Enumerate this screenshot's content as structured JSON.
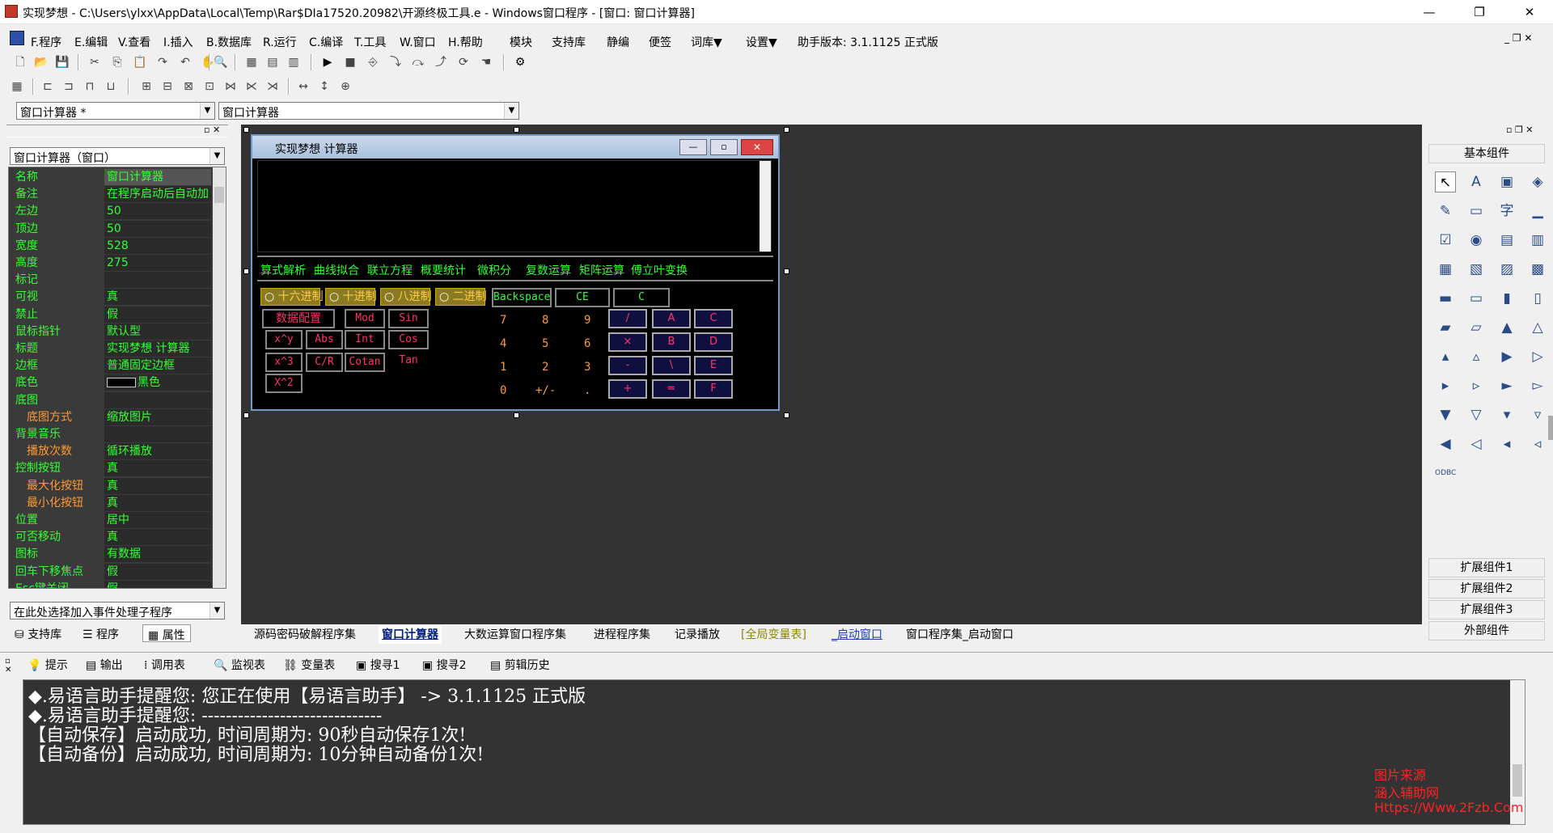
{
  "window": {
    "title": "实现梦想 - C:\\Users\\ylxx\\AppData\\Local\\Temp\\Rar$DIa17520.20982\\开源终极工具.e - Windows窗口程序 - [窗口: 窗口计算器]",
    "minimize": "—",
    "restore": "❐",
    "close": "✕"
  },
  "menu": [
    {
      "label": "F.程序"
    },
    {
      "label": "E.编辑"
    },
    {
      "label": "V.查看"
    },
    {
      "label": "I.插入"
    },
    {
      "label": "B.数据库"
    },
    {
      "label": "R.运行"
    },
    {
      "label": "C.编译"
    },
    {
      "label": "T.工具"
    },
    {
      "label": "W.窗口"
    },
    {
      "label": "H.帮助"
    },
    {
      "label": "模块"
    },
    {
      "label": "支持库"
    },
    {
      "label": "静编"
    },
    {
      "label": "便签"
    },
    {
      "label": "词库▼"
    },
    {
      "label": "设置▼"
    },
    {
      "label": "助手版本: 3.1.1125 正式版"
    }
  ],
  "combos": {
    "left": "窗口计算器 *",
    "right": "窗口计算器",
    "object": "窗口计算器（窗口）",
    "event": "在此处选择加入事件处理子程序"
  },
  "properties": [
    {
      "name": "名称",
      "value": "窗口计算器",
      "sub": false
    },
    {
      "name": "备注",
      "value": "在程序启动后自动加",
      "sub": false
    },
    {
      "name": "左边",
      "value": "50",
      "sub": false
    },
    {
      "name": "顶边",
      "value": "50",
      "sub": false
    },
    {
      "name": "宽度",
      "value": "528",
      "sub": false
    },
    {
      "name": "高度",
      "value": "275",
      "sub": false
    },
    {
      "name": "标记",
      "value": "",
      "sub": false
    },
    {
      "name": "可视",
      "value": "真",
      "sub": false
    },
    {
      "name": "禁止",
      "value": "假",
      "sub": false
    },
    {
      "name": "鼠标指针",
      "value": "默认型",
      "sub": false
    },
    {
      "name": "标题",
      "value": "实现梦想  计算器",
      "sub": false
    },
    {
      "name": "边框",
      "value": "普通固定边框",
      "sub": false
    },
    {
      "name": "底色",
      "value": "黑色",
      "sub": false
    },
    {
      "name": "底图",
      "value": "",
      "sub": false
    },
    {
      "name": "底图方式",
      "value": "缩放图片",
      "sub": true
    },
    {
      "name": "背景音乐",
      "value": "",
      "sub": false
    },
    {
      "name": "播放次数",
      "value": "循环播放",
      "sub": true
    },
    {
      "name": "控制按钮",
      "value": "真",
      "sub": false
    },
    {
      "name": "最大化按钮",
      "value": "真",
      "sub": true
    },
    {
      "name": "最小化按钮",
      "value": "真",
      "sub": true
    },
    {
      "name": "位置",
      "value": "居中",
      "sub": false
    },
    {
      "name": "可否移动",
      "value": "真",
      "sub": false
    },
    {
      "name": "图标",
      "value": "有数据",
      "sub": false
    },
    {
      "name": "回车下移焦点",
      "value": "假",
      "sub": false
    },
    {
      "name": "Esc键关闭",
      "value": "假",
      "sub": false
    }
  ],
  "left_tabs": [
    "支持库",
    "程序",
    "属性"
  ],
  "calc": {
    "title": "实现梦想  计算器",
    "functions": [
      "算式解析",
      "曲线拟合",
      "联立方程",
      "概要统计",
      "微积分",
      "复数运算",
      "矩阵运算",
      "傅立叶变换"
    ],
    "radios": [
      "十六进制",
      "十进制",
      "八进制",
      "二进制"
    ],
    "top_buttons": [
      "Backspace",
      "CE",
      "C"
    ],
    "left_buttons": [
      "数据配置",
      "Mod",
      "Sin",
      "x^y",
      "Abs",
      "Int",
      "Cos",
      "x^3",
      "C/R",
      "Cotan",
      "Tan",
      "X^2"
    ],
    "digits": [
      "7",
      "8",
      "9",
      "4",
      "5",
      "6",
      "1",
      "2",
      "3",
      "0",
      "+/-",
      "."
    ],
    "ops": [
      "/",
      "A",
      "C",
      "×",
      "B",
      "D",
      "-",
      "\\",
      "E",
      "+",
      "=",
      "F"
    ]
  },
  "right_panel": {
    "header": "基本组件",
    "ext": [
      "扩展组件1",
      "扩展组件2",
      "扩展组件3",
      "外部组件"
    ],
    "icons": [
      "↖",
      "A",
      "▣",
      "◈",
      "✎",
      "▭",
      "字",
      "▁",
      "☑",
      "◉",
      "▤",
      "▥",
      "▦",
      "▧",
      "▨",
      "▩",
      "▬",
      "▭",
      "▮",
      "▯",
      "▰",
      "▱",
      "▲",
      "△",
      "▴",
      "▵",
      "▶",
      "▷",
      "▸",
      "▹",
      "►",
      "▻",
      "▼",
      "▽",
      "▾",
      "▿",
      "◀",
      "◁",
      "◂",
      "◃",
      "ODBC"
    ]
  },
  "tabs": [
    "源码密码破解程序集",
    "窗口计算器",
    "大数运算窗口程序集",
    "进程程序集",
    "记录播放",
    "[全局变量表]",
    "_启动窗口",
    "窗口程序集_启动窗口"
  ],
  "bottom_tabs": [
    "提示",
    "输出",
    "调用表",
    "监视表",
    "变量表",
    "搜寻1",
    "搜寻2",
    "剪辑历史"
  ],
  "output": [
    "◆.易语言助手提醒您: 您正在使用【易语言助手】 -> 3.1.1125 正式版",
    "◆.易语言助手提醒您: ------------------------------",
    "【自动保存】启动成功, 时间周期为: 90秒自动保存1次!",
    "【自动备份】启动成功, 时间周期为: 10分钟自动备份1次!"
  ],
  "watermark": [
    "图片来源",
    "涵入辅助网",
    "Https://Www.2Fzb.Com"
  ]
}
